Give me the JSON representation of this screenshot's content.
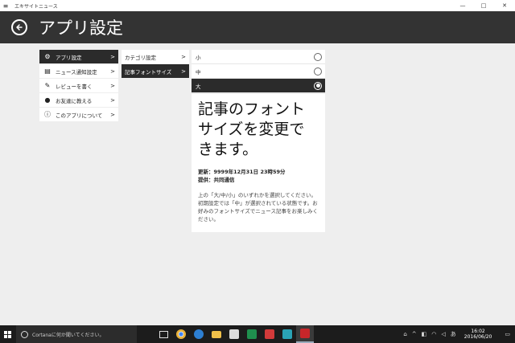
{
  "window": {
    "title": "エキサイトニュース",
    "menu_icon": "hamburger-icon",
    "controls": {
      "minimize": "—",
      "maximize": "□",
      "close": "✕"
    }
  },
  "header": {
    "back_icon": "back-arrow-icon",
    "title": "アプリ設定"
  },
  "menu": {
    "items": [
      {
        "label": "アプリ設定",
        "icon": "gear-icon",
        "arrow": ">",
        "active": true
      },
      {
        "label": "ニュース通知設定",
        "icon": "newspaper-icon",
        "arrow": ">",
        "active": false
      },
      {
        "label": "レビューを書く",
        "icon": "edit-icon",
        "arrow": ">",
        "active": false
      },
      {
        "label": "お友達に教える",
        "icon": "chat-icon",
        "arrow": ">",
        "active": false
      },
      {
        "label": "このアプリについて",
        "icon": "info-icon",
        "arrow": ">",
        "active": false
      }
    ]
  },
  "submenu": {
    "items": [
      {
        "label": "カテゴリ設定",
        "arrow": ">",
        "active": false
      },
      {
        "label": "記事フォントサイズ",
        "arrow": ">",
        "active": true
      }
    ]
  },
  "font_options": {
    "items": [
      {
        "label": "小",
        "selected": false
      },
      {
        "label": "中",
        "selected": false
      },
      {
        "label": "大",
        "selected": true
      }
    ]
  },
  "preview": {
    "heading": "記事のフォントサイズを変更できます。",
    "updated": "更新：9999年12月31日 23時59分",
    "provider": "提供：共同通信",
    "body": "上の「大/中/小」のいずれかを選択してください。初期設定では「中」が選択されている状態です。お好みのフォントサイズでニュース記事をお楽しみください。"
  },
  "taskbar": {
    "search_placeholder": "Cortanaに何か聞いてください。",
    "apps": [
      {
        "name": "task-view-icon",
        "color": "#dddddd"
      },
      {
        "name": "chrome-icon",
        "color": "#e8b13a"
      },
      {
        "name": "edge-icon",
        "color": "#2d7fd3"
      },
      {
        "name": "file-explorer-icon",
        "color": "#f0c04a"
      },
      {
        "name": "store-icon",
        "color": "#dddddd"
      },
      {
        "name": "excel-icon",
        "color": "#1f8f4e"
      },
      {
        "name": "app-red-icon",
        "color": "#d23a3a"
      },
      {
        "name": "app-teal-icon",
        "color": "#2aa3b5"
      },
      {
        "name": "excite-news-icon",
        "color": "#c8262a"
      }
    ],
    "time": "16:02",
    "date": "2016/06/20"
  }
}
